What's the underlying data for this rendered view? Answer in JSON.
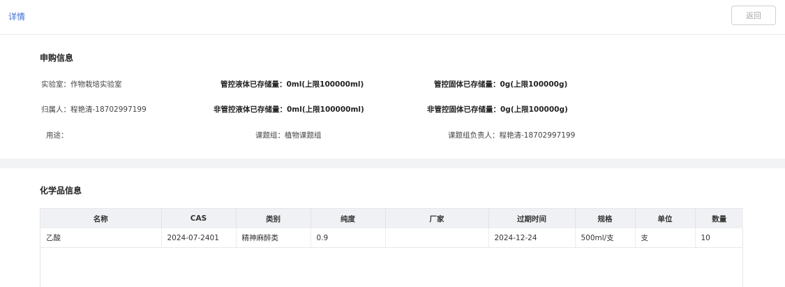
{
  "header": {
    "title": "详情",
    "back_label": "返回"
  },
  "purchase_info": {
    "title": "申购信息",
    "rows": [
      [
        "实验室：作物栽培实验室",
        "管控液体已存储量：0ml(上限100000ml)",
        "管控固体已存储量：0g(上限100000g)"
      ],
      [
        "归属人：程艳清-18702997199",
        "非管控液体已存储量：0ml(上限100000ml)",
        "非管控固体已存储量：0g(上限100000g)"
      ],
      [
        "用途：",
        "课题组：植物课题组",
        "课题组负责人：程艳清-18702997199"
      ]
    ]
  },
  "chemical_info": {
    "title": "化学品信息",
    "columns": [
      "名称",
      "CAS",
      "类别",
      "纯度",
      "厂家",
      "过期时间",
      "规格",
      "单位",
      "数量"
    ],
    "rows": [
      [
        "乙酸",
        "2024-07-2401",
        "精神麻醉类",
        "0.9",
        "",
        "2024-12-24",
        "500ml/支",
        "支",
        "10"
      ]
    ]
  }
}
